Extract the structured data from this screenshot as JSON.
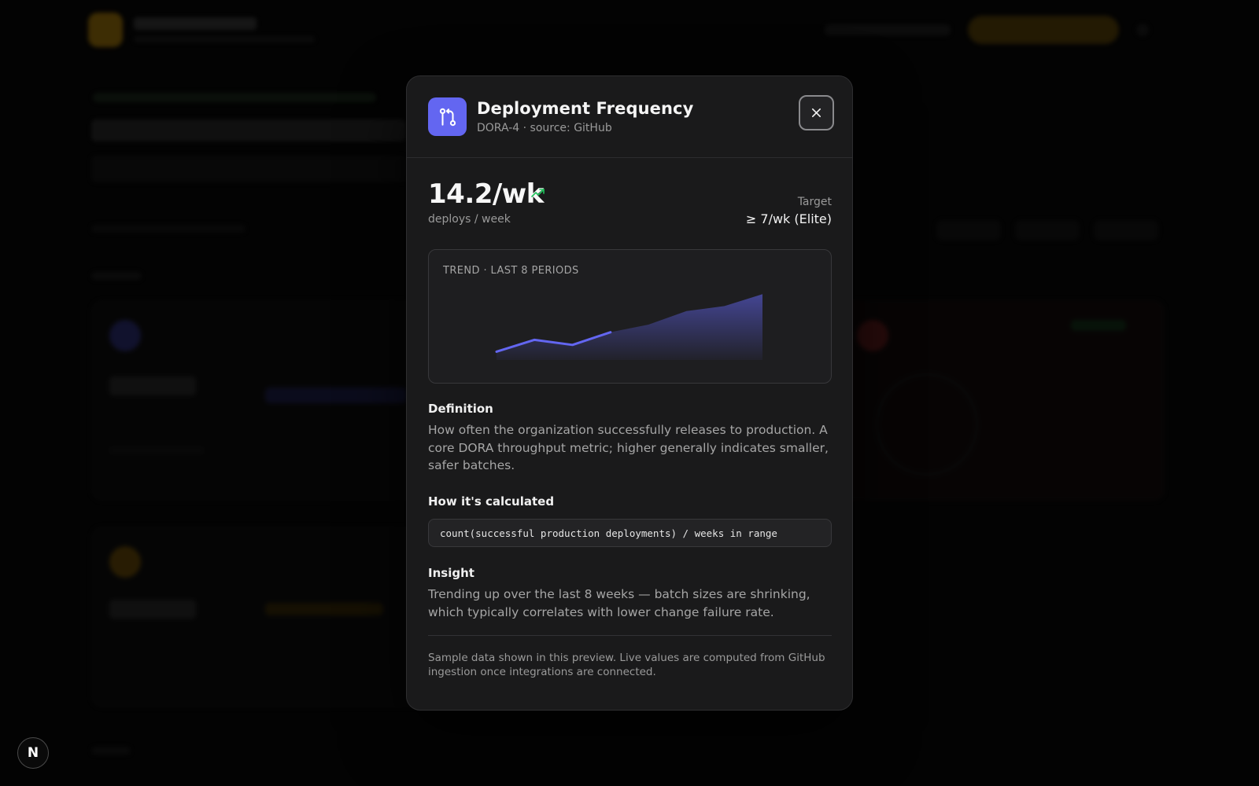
{
  "modal": {
    "title": "Deployment Frequency",
    "subtitle": "DORA-4 · source: GitHub",
    "icon": "git-branch-icon",
    "close_icon": "close-icon",
    "value": "14.2/wk",
    "trend_icon": "trend-up-icon",
    "unit": "deploys / week",
    "target_label": "Target",
    "target_value": "≥ 7/wk (Elite)",
    "chart": {
      "label": "TREND · LAST 8 PERIODS"
    },
    "definition_title": "Definition",
    "definition_text": "How often the organization successfully releases to production. A core DORA throughput metric; higher generally indicates smaller, safer batches.",
    "calc_title": "How it's calculated",
    "calc_formula": "count(successful production deployments) / weeks in range",
    "insight_title": "Insight",
    "insight_text": "Trending up over the last 8 weeks — batch sizes are shrinking, which typically correlates with lower change failure rate.",
    "footnote": "Sample data shown in this preview. Live values are computed from GitHub ingestion once integrations are connected."
  },
  "colors": {
    "accent": "#6366f1",
    "positive": "#22c55e"
  },
  "next_badge": "N",
  "chart_data": {
    "type": "area",
    "x": [
      1,
      2,
      3,
      4,
      5,
      6,
      7,
      8
    ],
    "values": [
      10.8,
      12.2,
      11.6,
      13.1,
      14.0,
      15.6,
      16.2,
      17.6
    ],
    "highlight_range": [
      1,
      4
    ],
    "title": "TREND · LAST 8 PERIODS",
    "xlabel": "",
    "ylabel": "",
    "grid": false,
    "legend": "none"
  }
}
